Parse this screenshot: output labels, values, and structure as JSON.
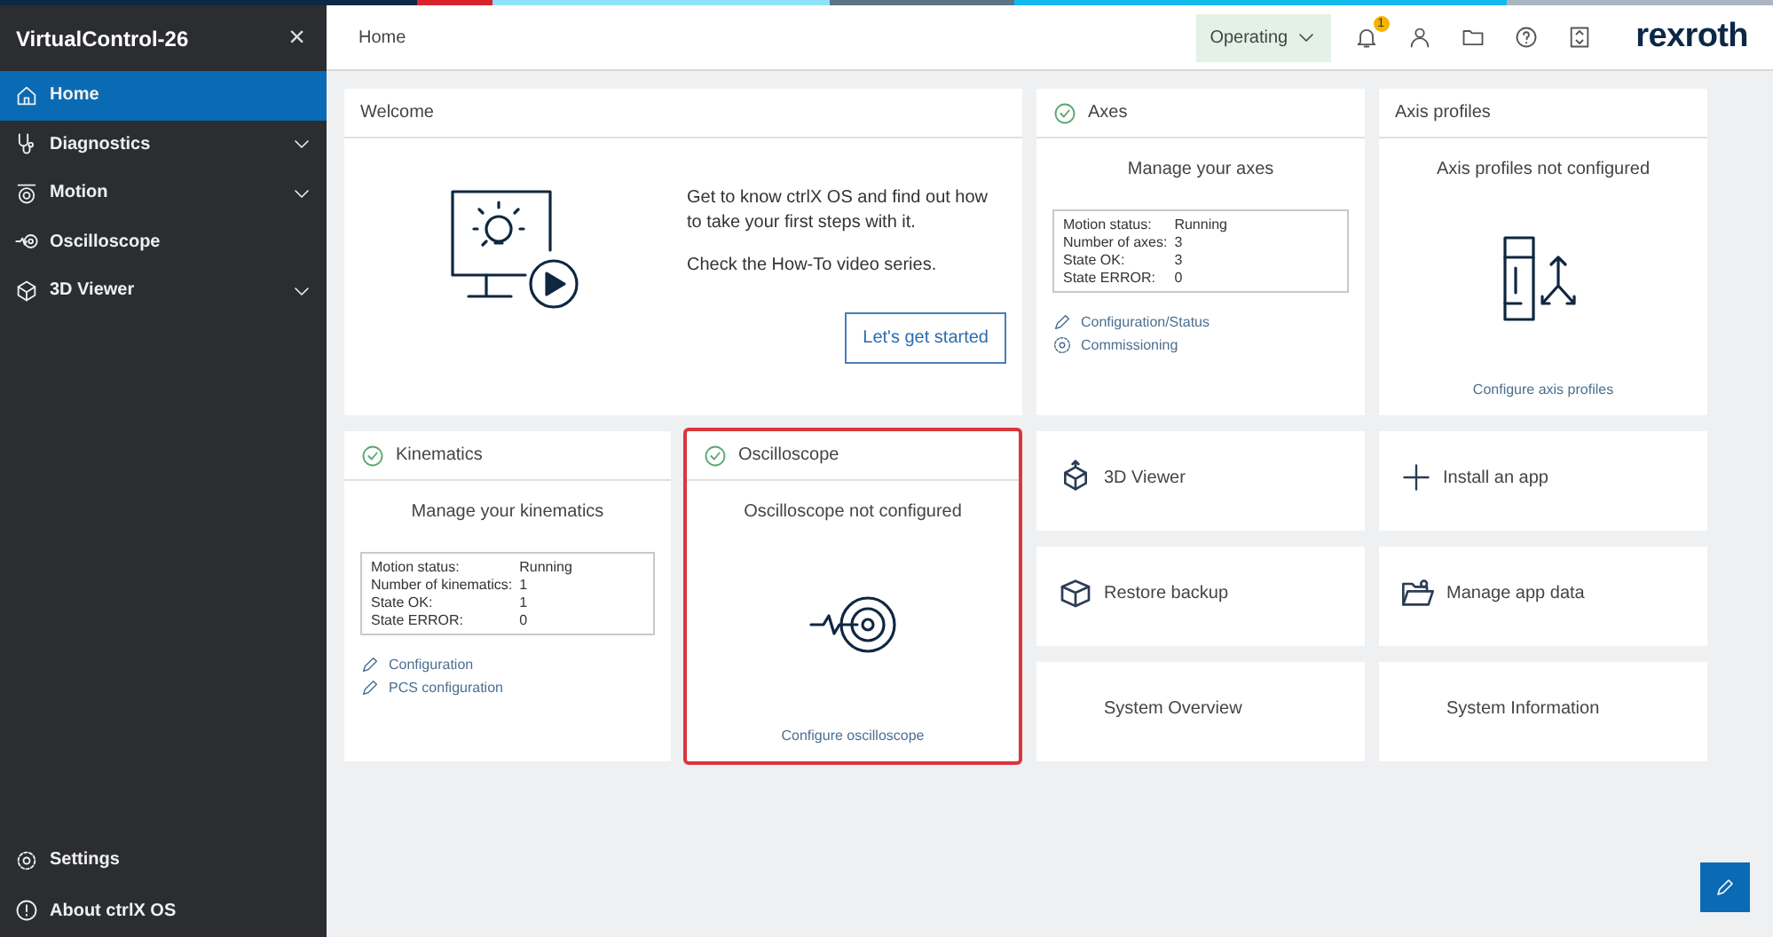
{
  "sidebar": {
    "title": "VirtualControl-26",
    "close": "×",
    "items": [
      {
        "label": "Home",
        "kind": "home",
        "selected": true,
        "expandable": false
      },
      {
        "label": "Diagnostics",
        "kind": "diagnostics",
        "selected": false,
        "expandable": true
      },
      {
        "label": "Motion",
        "kind": "motion",
        "selected": false,
        "expandable": true
      },
      {
        "label": "Oscilloscope",
        "kind": "oscilloscope",
        "selected": false,
        "expandable": false
      },
      {
        "label": "3D Viewer",
        "kind": "viewer",
        "selected": false,
        "expandable": true
      }
    ],
    "footer": [
      {
        "label": "Settings",
        "kind": "settings"
      },
      {
        "label": "About ctrlX OS",
        "kind": "about"
      }
    ]
  },
  "header": {
    "breadcrumb": "Home",
    "mode": "Operating",
    "notification_count": "1",
    "logo": "rexroth"
  },
  "cards": [
    {
      "kind": "welcome",
      "title": "Welcome",
      "ok": false,
      "highlighted": false,
      "paragraphs": [
        "Get to know ctrlX OS and find out how to take your first steps with it.",
        "Check the How-To video series."
      ],
      "button": "Let's get started"
    },
    {
      "kind": "axes",
      "title": "Axes",
      "ok": true,
      "highlighted": false,
      "subtitle": "Manage your axes",
      "info": [
        [
          "Motion status:",
          "Running"
        ],
        [
          "Number of axes:",
          "3"
        ],
        [
          "State OK:",
          "3"
        ],
        [
          "State ERROR:",
          "0"
        ]
      ],
      "links": [
        {
          "label": "Configuration/Status"
        },
        {
          "label": "Commissioning"
        }
      ]
    },
    {
      "kind": "axis_profiles",
      "title": "Axis profiles",
      "ok": false,
      "highlighted": false,
      "subtitle": "Axis profiles not configured",
      "link": "Configure axis profiles"
    },
    {
      "kind": "kinematics",
      "title": "Kinematics",
      "ok": true,
      "highlighted": false,
      "subtitle": "Manage your kinematics",
      "info": [
        [
          "Motion status:",
          "Running"
        ],
        [
          "Number of kinematics:",
          "1"
        ],
        [
          "State OK:",
          "1"
        ],
        [
          "State ERROR:",
          "0"
        ]
      ],
      "links": [
        {
          "label": "Configuration"
        },
        {
          "label": "PCS configuration"
        }
      ]
    },
    {
      "kind": "oscilloscope",
      "title": "Oscilloscope",
      "ok": true,
      "highlighted": true,
      "subtitle": "Oscilloscope not configured",
      "link": "Configure oscilloscope"
    },
    {
      "kind": "tile",
      "label": "3D Viewer"
    },
    {
      "kind": "tile",
      "label": "Install an app"
    },
    {
      "kind": "tile",
      "label": "Restore backup"
    },
    {
      "kind": "tile",
      "label": "Manage app data"
    },
    {
      "kind": "tile",
      "label": "System Overview"
    },
    {
      "kind": "tile",
      "label": "System Information"
    }
  ]
}
